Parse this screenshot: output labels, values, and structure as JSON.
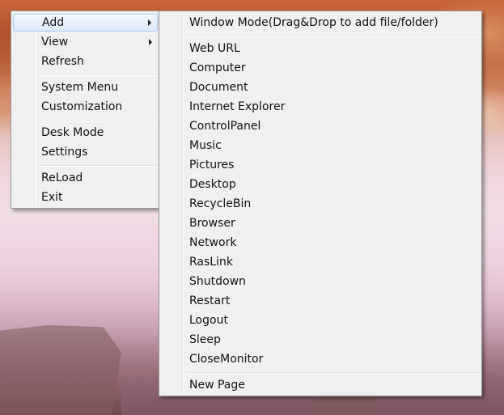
{
  "main_menu": {
    "items": [
      {
        "label": "Add",
        "has_submenu": true,
        "active": true
      },
      {
        "label": "View",
        "has_submenu": true
      },
      {
        "label": "Refresh"
      },
      {
        "label": "System Menu"
      },
      {
        "label": "Customization"
      },
      {
        "label": "Desk Mode"
      },
      {
        "label": "Settings"
      },
      {
        "label": "ReLoad"
      },
      {
        "label": "Exit"
      }
    ]
  },
  "sub_menu": {
    "items": [
      {
        "label": "Window Mode(Drag&Drop to add file/folder)"
      },
      {
        "label": "Web URL"
      },
      {
        "label": "Computer"
      },
      {
        "label": "Document"
      },
      {
        "label": "Internet Explorer"
      },
      {
        "label": "ControlPanel"
      },
      {
        "label": "Music"
      },
      {
        "label": "Pictures"
      },
      {
        "label": "Desktop"
      },
      {
        "label": "RecycleBin"
      },
      {
        "label": "Browser"
      },
      {
        "label": "Network"
      },
      {
        "label": "RasLink"
      },
      {
        "label": "Shutdown"
      },
      {
        "label": "Restart"
      },
      {
        "label": "Logout"
      },
      {
        "label": "Sleep"
      },
      {
        "label": "CloseMonitor"
      },
      {
        "label": "New Page"
      }
    ]
  },
  "colors": {
    "menu_background": "#f0f0f0",
    "menu_border": "#979797",
    "highlight_border": "#aeccf1",
    "highlight_fill": "#dde9fb"
  }
}
